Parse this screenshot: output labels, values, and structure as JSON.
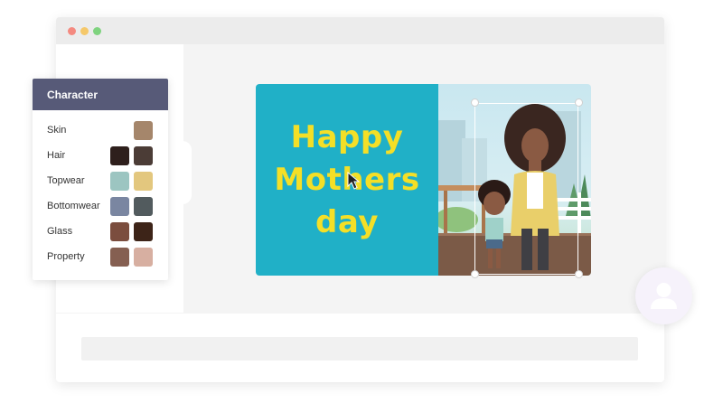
{
  "window": {
    "controls": {
      "close_color": "#f48a80",
      "minimize_color": "#f5c86a",
      "maximize_color": "#7fd37f"
    }
  },
  "character_panel": {
    "title": "Character",
    "header_color": "#575a78",
    "rows": [
      {
        "label": "Skin",
        "swatches": [
          "#a5866b"
        ]
      },
      {
        "label": "Hair",
        "swatches": [
          "#2e1f1c",
          "#4b3c36"
        ]
      },
      {
        "label": "Topwear",
        "swatches": [
          "#9cc5c1",
          "#e3c77e"
        ]
      },
      {
        "label": "Bottomwear",
        "swatches": [
          "#7a86a1",
          "#525b5e"
        ]
      },
      {
        "label": "Glass",
        "swatches": [
          "#7b4d3e",
          "#3d2418"
        ]
      },
      {
        "label": "Property",
        "swatches": [
          "#855f51",
          "#d7afa1"
        ]
      }
    ]
  },
  "scene": {
    "title_line1": "Happy",
    "title_line2": "Mothers",
    "title_line3": "day",
    "background_color": "#20b0c7",
    "title_color": "#f4df27"
  },
  "icons": {
    "cursor": "mouse-pointer-icon",
    "user": "user-icon"
  }
}
